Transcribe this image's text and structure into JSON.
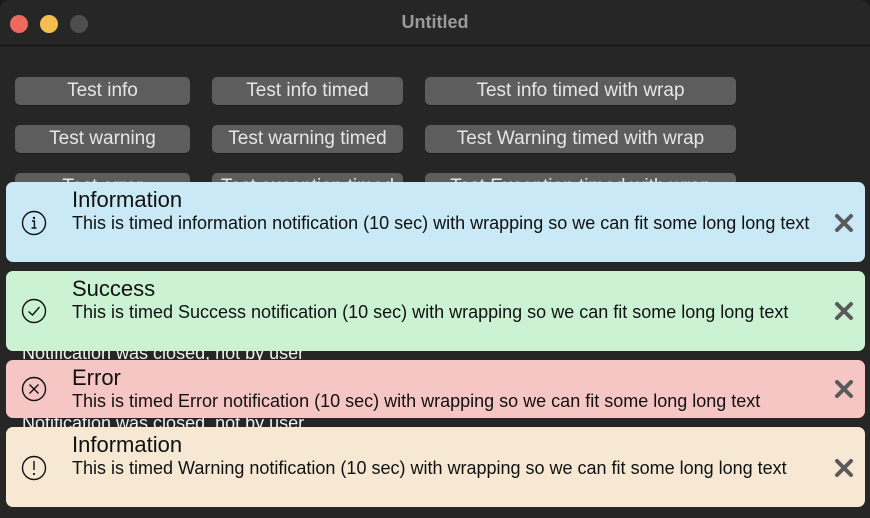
{
  "window": {
    "title": "Untitled"
  },
  "buttons": {
    "row1": [
      "Test info",
      "Test info timed",
      "Test info timed with wrap"
    ],
    "row2": [
      "Test warning",
      "Test warning timed",
      "Test Warning timed with wrap"
    ],
    "row3": [
      "Test error",
      "Test exception timed",
      "Test Exception timed with wrap"
    ]
  },
  "status_messages": [
    "Notification was closed, not by user",
    "Notification was closed, not by user"
  ],
  "notifications": [
    {
      "type": "info",
      "icon": "info-circle-icon",
      "title": "Information",
      "message": "This is timed information notification (10 sec) with wrapping so we can fit some long long text",
      "color": "#c8e9f5"
    },
    {
      "type": "success",
      "icon": "check-circle-icon",
      "title": "Success",
      "message": "This is timed Success notification (10 sec) with wrapping so we can fit some long long text",
      "color": "#cbf3d3"
    },
    {
      "type": "error",
      "icon": "x-circle-icon",
      "title": "Error",
      "message": "This is timed Error notification (10 sec) with wrapping so we can fit some long long text",
      "color": "#f6c6c4"
    },
    {
      "type": "warning",
      "icon": "exclamation-circle-icon",
      "title": "Information",
      "message": "This is timed Warning notification (10 sec) with wrapping so we can fit some long long text",
      "color": "#f6e8d3"
    }
  ]
}
